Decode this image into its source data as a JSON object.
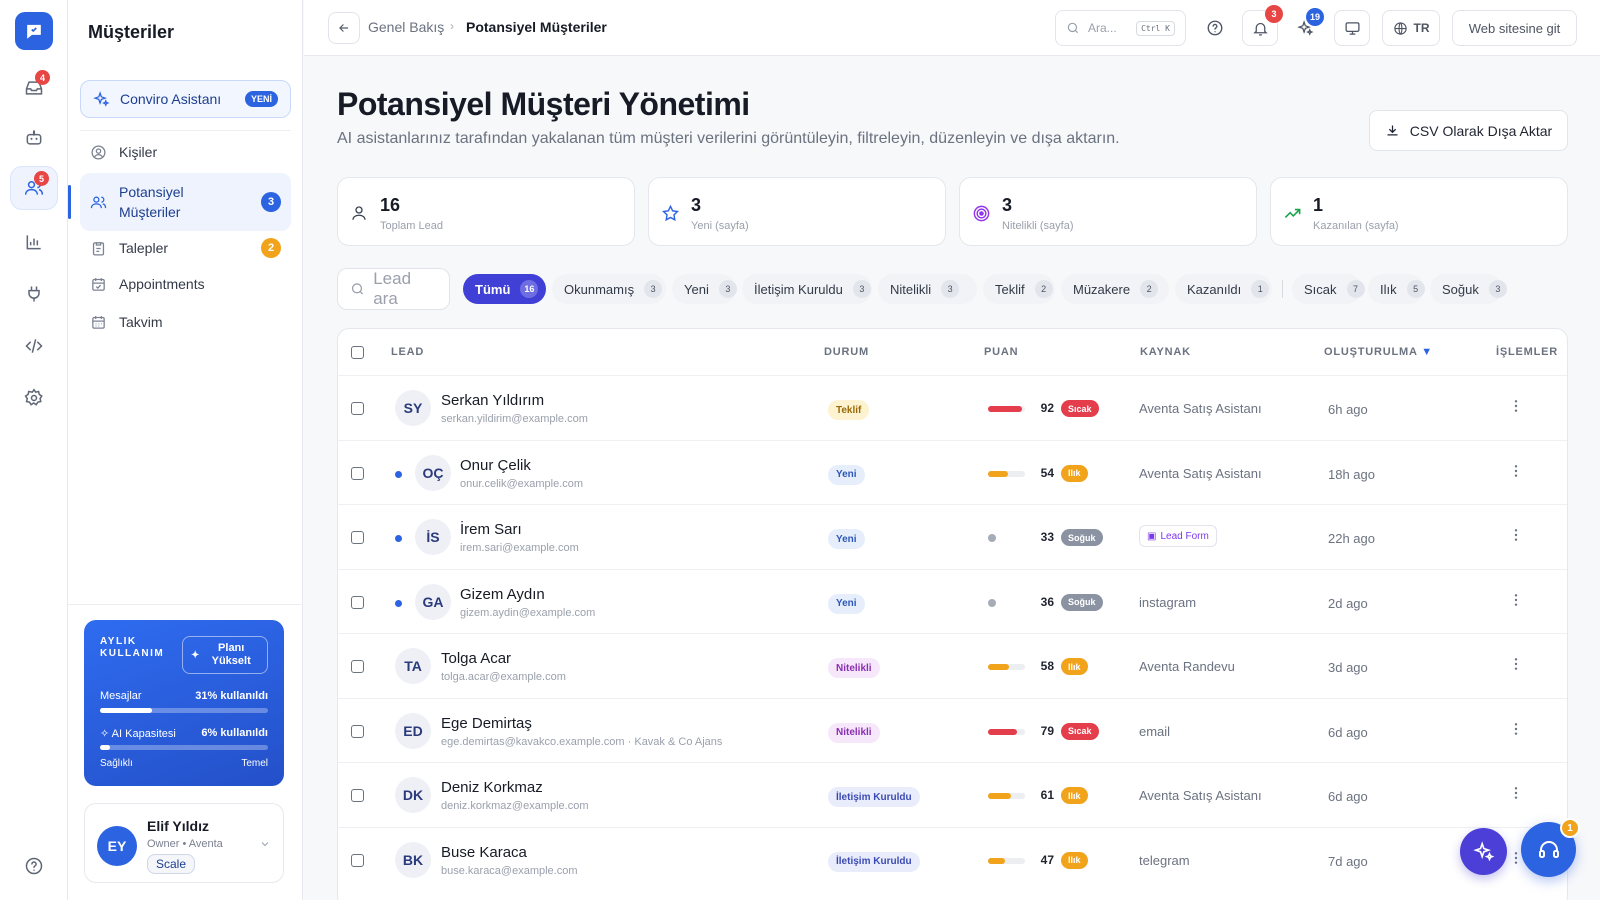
{
  "rail": {
    "inbox_badge": "4",
    "contacts_badge": "5"
  },
  "sidebar": {
    "title": "Müşteriler",
    "assistant_label": "Conviro Asistanı",
    "assistant_badge": "YENİ",
    "items": [
      {
        "label": "Kişiler",
        "icon": "user-circle-icon"
      },
      {
        "label": "Potansiyel Müşteriler",
        "icon": "users-icon",
        "badge": "3"
      },
      {
        "label": "Talepler",
        "icon": "clipboard-icon",
        "badge": "2"
      },
      {
        "label": "Appointments",
        "icon": "calendar-icon"
      },
      {
        "label": "Takvim",
        "icon": "calendar-grid-icon"
      }
    ],
    "usage": {
      "title": "AYLIK KULLANIM",
      "upgrade_label": "Planı Yükselt",
      "messages_label": "Mesajlar",
      "messages_value": "31% kullanıldı",
      "messages_pct": 31,
      "ai_label": "AI Kapasitesi",
      "ai_value": "6% kullanıldı",
      "ai_pct": 6,
      "left_caption": "Sağlıklı",
      "right_caption": "Temel"
    },
    "user": {
      "initials": "EY",
      "name": "Elif Yıldız",
      "role": "Owner • Aventa",
      "plan": "Scale"
    }
  },
  "header": {
    "breadcrumb_parent": "Genel Bakış",
    "breadcrumb_current": "Potansiyel Müşteriler",
    "search_placeholder": "Ara...",
    "search_shortcut": "Ctrl K",
    "notifications_badge": "3",
    "ai_badge": "19",
    "language": "TR",
    "website_label": "Web sitesine git"
  },
  "page": {
    "title": "Potansiyel Müşteri Yönetimi",
    "subtitle": "AI asistanlarınız tarafından yakalanan tüm müşteri verilerini görüntüleyin, filtreleyin, düzenleyin ve dışa aktarın.",
    "export_label": "CSV Olarak Dışa Aktar"
  },
  "stats": [
    {
      "value": "16",
      "label": "Toplam Lead",
      "icon": "user-icon",
      "color": "#3a4150"
    },
    {
      "value": "3",
      "label": "Yeni (sayfa)",
      "icon": "star-icon",
      "color": "#2c63e0"
    },
    {
      "value": "3",
      "label": "Nitelikli (sayfa)",
      "icon": "target-icon",
      "color": "#9333ea"
    },
    {
      "value": "1",
      "label": "Kazanılan (sayfa)",
      "icon": "trend-up-icon",
      "color": "#16a34a"
    }
  ],
  "filters": {
    "search_placeholder": "Lead ara",
    "chips": [
      {
        "label": "Tümü",
        "count": "16"
      },
      {
        "label": "Okunmamış",
        "count": "3"
      },
      {
        "label": "Yeni",
        "count": "3"
      },
      {
        "label": "İletişim Kuruldu",
        "count": "3"
      },
      {
        "label": "Nitelikli",
        "count": "3"
      },
      {
        "label": "Teklif",
        "count": "2"
      },
      {
        "label": "Müzakere",
        "count": "2"
      },
      {
        "label": "Kazanıldı",
        "count": "1"
      },
      {
        "label": "Sıcak",
        "count": "7"
      },
      {
        "label": "Ilık",
        "count": "5"
      },
      {
        "label": "Soğuk",
        "count": "3"
      }
    ]
  },
  "table": {
    "columns": [
      "LEAD",
      "DURUM",
      "PUAN",
      "KAYNAK",
      "OLUŞTURULMA",
      "İŞLEMLER"
    ],
    "sort_indicator": "▼",
    "rows": [
      {
        "initials": "SY",
        "name": "Serkan Yıldırım",
        "email": "serkan.yildirim@example.com",
        "status": "Teklif",
        "score": 92,
        "temp": "Sıcak",
        "source": "Aventa Satış Asistanı",
        "created": "6h ago",
        "unread": false
      },
      {
        "initials": "OÇ",
        "name": "Onur Çelik",
        "email": "onur.celik@example.com",
        "status": "Yeni",
        "score": 54,
        "temp": "Ilık",
        "source": "Aventa Satış Asistanı",
        "created": "18h ago",
        "unread": true
      },
      {
        "initials": "İS",
        "name": "İrem Sarı",
        "email": "irem.sari@example.com",
        "status": "Yeni",
        "score": 33,
        "temp": "Soğuk",
        "source": "Lead Form",
        "source_badge": true,
        "created": "22h ago",
        "unread": true
      },
      {
        "initials": "GA",
        "name": "Gizem Aydın",
        "email": "gizem.aydin@example.com",
        "status": "Yeni",
        "score": 36,
        "temp": "Soğuk",
        "source": "instagram",
        "created": "2d ago",
        "unread": true
      },
      {
        "initials": "TA",
        "name": "Tolga Acar",
        "email": "tolga.acar@example.com",
        "status": "Nitelikli",
        "score": 58,
        "temp": "Ilık",
        "source": "Aventa Randevu",
        "created": "3d ago",
        "unread": false
      },
      {
        "initials": "ED",
        "name": "Ege Demirtaş",
        "email": "ege.demirtas@kavakco.example.com · Kavak & Co Ajans",
        "status": "Nitelikli",
        "score": 79,
        "temp": "Sıcak",
        "source": "email",
        "created": "6d ago",
        "unread": false
      },
      {
        "initials": "DK",
        "name": "Deniz Korkmaz",
        "email": "deniz.korkmaz@example.com",
        "status": "İletişim Kuruldu",
        "score": 61,
        "temp": "Ilık",
        "source": "Aventa Satış Asistanı",
        "created": "6d ago",
        "unread": false
      },
      {
        "initials": "BK",
        "name": "Buse Karaca",
        "email": "buse.karaca@example.com",
        "status": "İletişim Kuruldu",
        "score": 47,
        "temp": "Ilık",
        "source": "telegram",
        "created": "7d ago",
        "unread": false
      }
    ]
  },
  "support_badge": "1",
  "colors": {
    "accent": "#2c63e0",
    "hot": "#e43d4c",
    "warm": "#f0a31b",
    "cold": "#8b93a2",
    "chip_active": "#4140d6"
  }
}
